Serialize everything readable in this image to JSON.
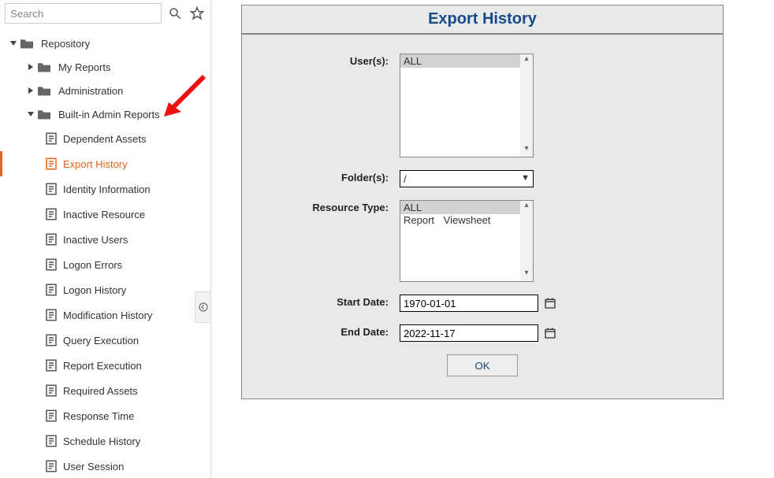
{
  "search": {
    "placeholder": "Search"
  },
  "tree": {
    "root_label": "Repository",
    "folders": [
      {
        "label": "My Reports"
      },
      {
        "label": "Administration"
      }
    ],
    "admin_folder_label": "Built-in Admin Reports",
    "reports": [
      "Dependent Assets",
      "Export History",
      "Identity Information",
      "Inactive Resource",
      "Inactive Users",
      "Logon Errors",
      "Logon History",
      "Modification History",
      "Query Execution",
      "Report Execution",
      "Required Assets",
      "Response Time",
      "Schedule History",
      "User Session"
    ],
    "active_index": 1
  },
  "panel": {
    "title": "Export History",
    "labels": {
      "users": "User(s):",
      "folders": "Folder(s):",
      "resource_type": "Resource Type:",
      "start_date": "Start Date:",
      "end_date": "End Date:",
      "ok": "OK"
    },
    "users_options": [
      "ALL"
    ],
    "users_selected": "ALL",
    "folders_value": "/",
    "resource_type_options": [
      "ALL",
      "Report",
      "Viewsheet"
    ],
    "resource_type_selected": "ALL",
    "start_date": "1970-01-01",
    "end_date": "2022-11-17"
  }
}
